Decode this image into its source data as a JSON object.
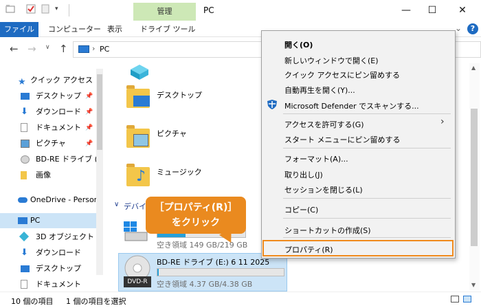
{
  "title_bar": {
    "context_tab": "管理",
    "window_title": "PC"
  },
  "ribbon": {
    "file_tab": "ファイル",
    "tabs": [
      "コンピューター",
      "表示",
      "ドライブ ツール"
    ]
  },
  "address": {
    "path": "PC"
  },
  "sidebar": {
    "items": [
      {
        "label": "クイック アクセス",
        "icon": "star-icon",
        "pinned": false
      },
      {
        "label": "デスクトップ",
        "icon": "desktop-icon",
        "pinned": true
      },
      {
        "label": "ダウンロード",
        "icon": "download-icon",
        "pinned": true
      },
      {
        "label": "ドキュメント",
        "icon": "document-icon",
        "pinned": true
      },
      {
        "label": "ピクチャ",
        "icon": "picture-icon",
        "pinned": true
      },
      {
        "label": "BD-RE ドライブ (E:",
        "icon": "disc-icon",
        "pinned": false
      },
      {
        "label": "画像",
        "icon": "folder-icon",
        "pinned": false
      },
      {
        "label": "OneDrive - Person",
        "icon": "cloud-icon",
        "pinned": false
      },
      {
        "label": "PC",
        "icon": "pc-icon",
        "pinned": false,
        "selected": true
      },
      {
        "label": "3D オブジェクト",
        "icon": "cube-icon",
        "pinned": false
      },
      {
        "label": "ダウンロード",
        "icon": "download-icon",
        "pinned": false
      },
      {
        "label": "デスクトップ",
        "icon": "desktop-icon",
        "pinned": false
      },
      {
        "label": "ドキュメント",
        "icon": "document-icon",
        "pinned": false
      }
    ]
  },
  "content": {
    "folders": [
      "デスクトップ",
      "ピクチャ",
      "ミュージック"
    ],
    "devices_header": "デバイス",
    "c_drive": {
      "space": "空き領域 149 GB/219 GB",
      "used_fraction": 0.32
    },
    "dvd_drive": {
      "name": "BD-RE ドライブ (E:) 6 11 2025",
      "space": "空き領域 4.37 GB/4.38 GB",
      "badge": "DVD-R",
      "used_fraction": 0.01
    }
  },
  "context_menu": {
    "items": [
      "開く(O)",
      "新しいウィンドウで開く(E)",
      "クイック アクセスにピン留めする",
      "自動再生を開く(Y)...",
      "Microsoft Defender でスキャンする...",
      "アクセスを許可する(G)",
      "スタート メニューにピン留めする",
      "フォーマット(A)...",
      "取り出し(J)",
      "セッションを閉じる(L)",
      "コピー(C)",
      "ショートカットの作成(S)",
      "プロパティ(R)"
    ]
  },
  "callout": {
    "line1": "［プロパティ(R)］",
    "line2": "をクリック"
  },
  "status": {
    "items": "10 個の項目",
    "selected": "1 個の項目を選択"
  }
}
